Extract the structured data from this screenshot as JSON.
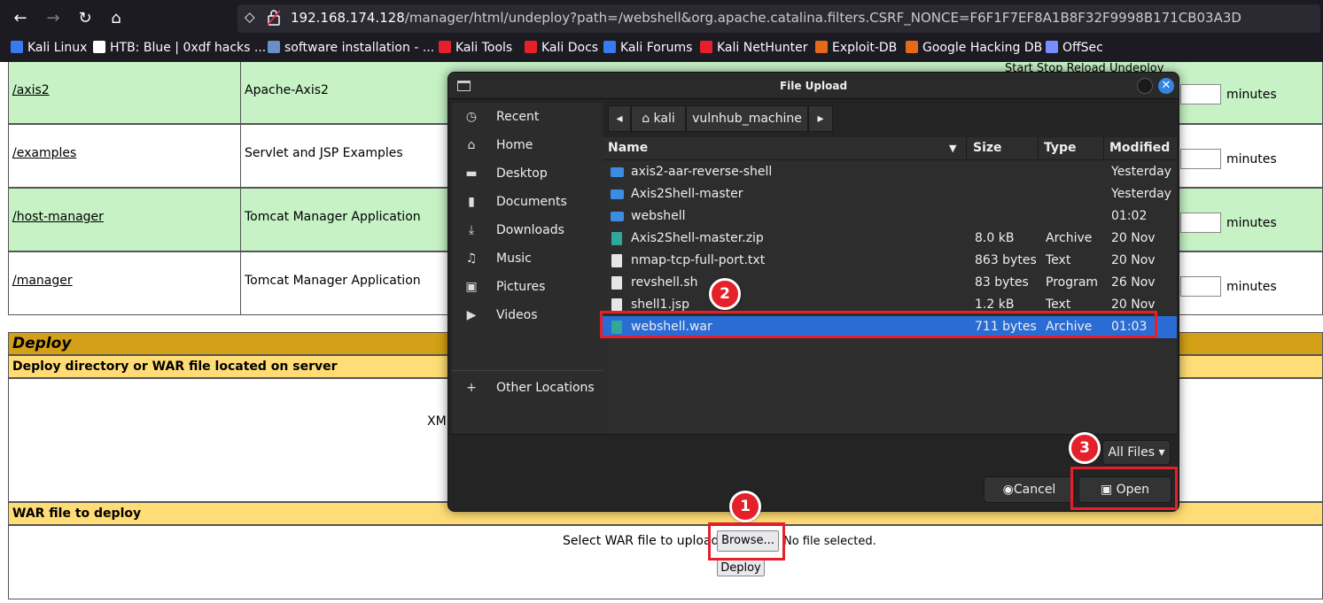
{
  "browser": {
    "url_host": "192.168.174.128",
    "url_path": "/manager/html/undeploy?path=/webshell&org.apache.catalina.filters.CSRF_NONCE=F6F1F7EF8A1B8F32F9998B171CB03A3D",
    "bookmarks": [
      {
        "label": "Kali Linux",
        "color": "#367bf0"
      },
      {
        "label": "HTB: Blue | 0xdf hacks ...",
        "color": "#ffffff"
      },
      {
        "label": "software installation - ...",
        "color": "#6a8ec7"
      },
      {
        "label": "Kali Tools",
        "color": "#e4202a"
      },
      {
        "label": "Kali Docs",
        "color": "#e4202a"
      },
      {
        "label": "Kali Forums",
        "color": "#367bf0"
      },
      {
        "label": "Kali NetHunter",
        "color": "#e4202a"
      },
      {
        "label": "Exploit-DB",
        "color": "#e46a1a"
      },
      {
        "label": "Google Hacking DB",
        "color": "#e46a1a"
      },
      {
        "label": "OffSec",
        "color": "#7a8cff"
      }
    ]
  },
  "apps": [
    {
      "path": "/axis2",
      "name": "Apache-Axis2"
    },
    {
      "path": "/examples",
      "name": "Servlet and JSP Examples"
    },
    {
      "path": "/host-manager",
      "name": "Tomcat Manager Application"
    },
    {
      "path": "/manager",
      "name": "Tomcat Manager Application"
    }
  ],
  "commands_header": "Start  Stop  Reload  Undeploy",
  "minutes_label": "minutes",
  "deploy": {
    "title": "Deploy",
    "server_section": "Deploy directory or WAR file located on server",
    "xm_fragment": "XM",
    "war_section": "WAR file to deploy",
    "select_label": "Select WAR file to upload",
    "browse_label": "Browse...",
    "no_file": "No file selected.",
    "deploy_button": "Deploy"
  },
  "dialog": {
    "title": "File Upload",
    "sidebar": [
      {
        "label": "Recent",
        "icon": "clock-icon",
        "glyph": "◷"
      },
      {
        "label": "Home",
        "icon": "home-icon",
        "glyph": "⌂"
      },
      {
        "label": "Desktop",
        "icon": "desktop-icon",
        "glyph": "▬"
      },
      {
        "label": "Documents",
        "icon": "document-icon",
        "glyph": "▮"
      },
      {
        "label": "Downloads",
        "icon": "download-icon",
        "glyph": "⤓"
      },
      {
        "label": "Music",
        "icon": "music-icon",
        "glyph": "♫"
      },
      {
        "label": "Pictures",
        "icon": "picture-icon",
        "glyph": "▣"
      },
      {
        "label": "Videos",
        "icon": "video-icon",
        "glyph": "▶"
      },
      {
        "label": "Other Locations",
        "icon": "plus-icon",
        "glyph": "+"
      }
    ],
    "breadcrumbs": [
      "kali",
      "vulnhub_machine"
    ],
    "columns": {
      "name": "Name",
      "size": "Size",
      "type": "Type",
      "modified": "Modified"
    },
    "files": [
      {
        "name": "axis2-aar-reverse-shell",
        "size": "",
        "type": "",
        "modified": "Yesterday",
        "kind": "folder"
      },
      {
        "name": "Axis2Shell-master",
        "size": "",
        "type": "",
        "modified": "Yesterday",
        "kind": "folder"
      },
      {
        "name": "webshell",
        "size": "",
        "type": "",
        "modified": "01:02",
        "kind": "folder"
      },
      {
        "name": "Axis2Shell-master.zip",
        "size": "8.0 kB",
        "type": "Archive",
        "modified": "20 Nov",
        "kind": "zip"
      },
      {
        "name": "nmap-tcp-full-port.txt",
        "size": "863 bytes",
        "type": "Text",
        "modified": "20 Nov",
        "kind": "doc"
      },
      {
        "name": "revshell.sh",
        "size": "83 bytes",
        "type": "Program",
        "modified": "26 Nov",
        "kind": "doc"
      },
      {
        "name": "shell1.jsp",
        "size": "1.2 kB",
        "type": "Text",
        "modified": "20 Nov",
        "kind": "doc"
      },
      {
        "name": "webshell.war",
        "size": "711 bytes",
        "type": "Archive",
        "modified": "01:03",
        "kind": "zip",
        "selected": true
      }
    ],
    "filter_label": "All Files",
    "cancel_label": "Cancel",
    "open_label": "Open"
  },
  "annotations": [
    "1",
    "2",
    "3"
  ],
  "colors": {
    "annotation": "#e4202a",
    "selection": "#2b6cd4",
    "app_row_green": "#c6f2c6",
    "deploy_header": "#d4a017",
    "section_header": "#ffdc75"
  }
}
